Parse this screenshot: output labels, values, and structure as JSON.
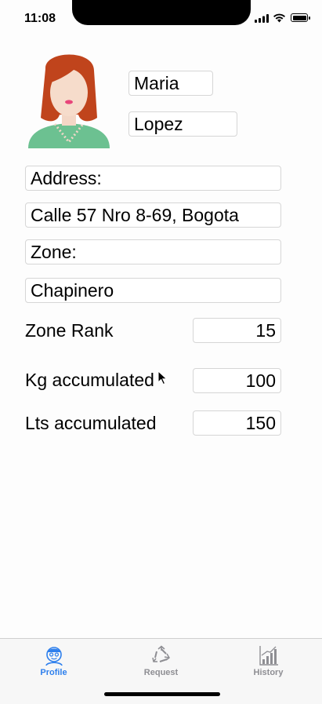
{
  "status_bar": {
    "time": "11:08"
  },
  "profile": {
    "first_name": "Maria",
    "last_name": "Lopez",
    "address_label": "Address:",
    "address_value": "Calle 57 Nro 8-69, Bogota",
    "zone_label": "Zone:",
    "zone_value": "Chapinero"
  },
  "stats": {
    "zone_rank_label": "Zone Rank",
    "zone_rank_value": "15",
    "kg_label": "Kg accumulated",
    "kg_value": "100",
    "lts_label": "Lts accumulated",
    "lts_value": "150"
  },
  "tabbar": {
    "tabs": [
      {
        "label": "Profile",
        "icon": "profile-icon",
        "active": true
      },
      {
        "label": "Request",
        "icon": "recycle-icon",
        "active": false
      },
      {
        "label": "History",
        "icon": "chart-icon",
        "active": false
      }
    ]
  },
  "colors": {
    "accent": "#2f80ed",
    "inactive": "#8e8e93",
    "hair": "#c0441c",
    "shirt": "#6cc191"
  }
}
